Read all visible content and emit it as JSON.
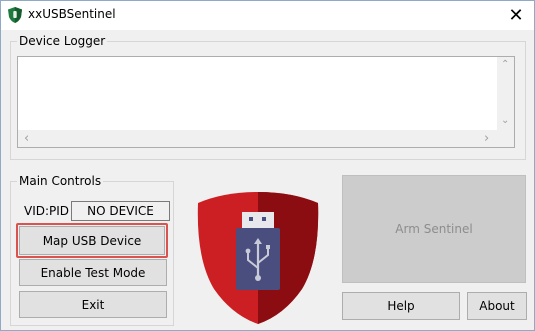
{
  "window": {
    "title": "xxUSBSentinel",
    "close_glyph": "✕"
  },
  "logger": {
    "group_label": "Device Logger",
    "arrow_up": "⌃",
    "arrow_down": "⌄",
    "arrow_left": "‹",
    "arrow_right": "›"
  },
  "controls": {
    "group_label": "Main Controls",
    "vidpid_label": "VID:PID",
    "vidpid_value": "NO DEVICE",
    "map_button": "Map USB Device",
    "test_button": "Enable Test Mode",
    "exit_button": "Exit"
  },
  "right": {
    "arm_button": "Arm Sentinel",
    "help_button": "Help",
    "about_button": "About"
  },
  "colors": {
    "shield_red": "#cc1f24",
    "shield_dark": "#8b0d12",
    "usb_body": "#4a4e7e",
    "highlight": "#d9534f"
  }
}
